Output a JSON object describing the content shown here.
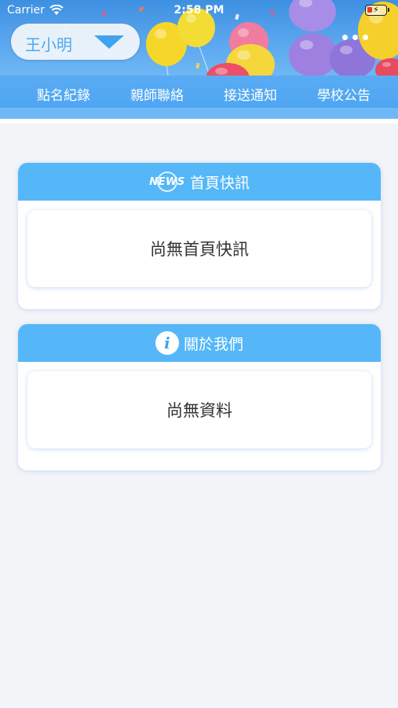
{
  "status_bar": {
    "carrier": "Carrier",
    "time": "2:58 PM"
  },
  "header": {
    "selected_user": "王小明"
  },
  "tabs": [
    {
      "label": "點名紀錄"
    },
    {
      "label": "親師聯絡"
    },
    {
      "label": "接送通知"
    },
    {
      "label": "學校公告"
    }
  ],
  "news_card": {
    "icon_text": "NEWS",
    "title": "首頁快訊",
    "empty_text": "尚無首頁快訊"
  },
  "about_card": {
    "icon_text": "i",
    "title": "關於我們",
    "empty_text": "尚無資料"
  },
  "colors": {
    "accent": "#4aa4f2",
    "card_header": "#55b7f7",
    "background": "#f2f4f7"
  }
}
